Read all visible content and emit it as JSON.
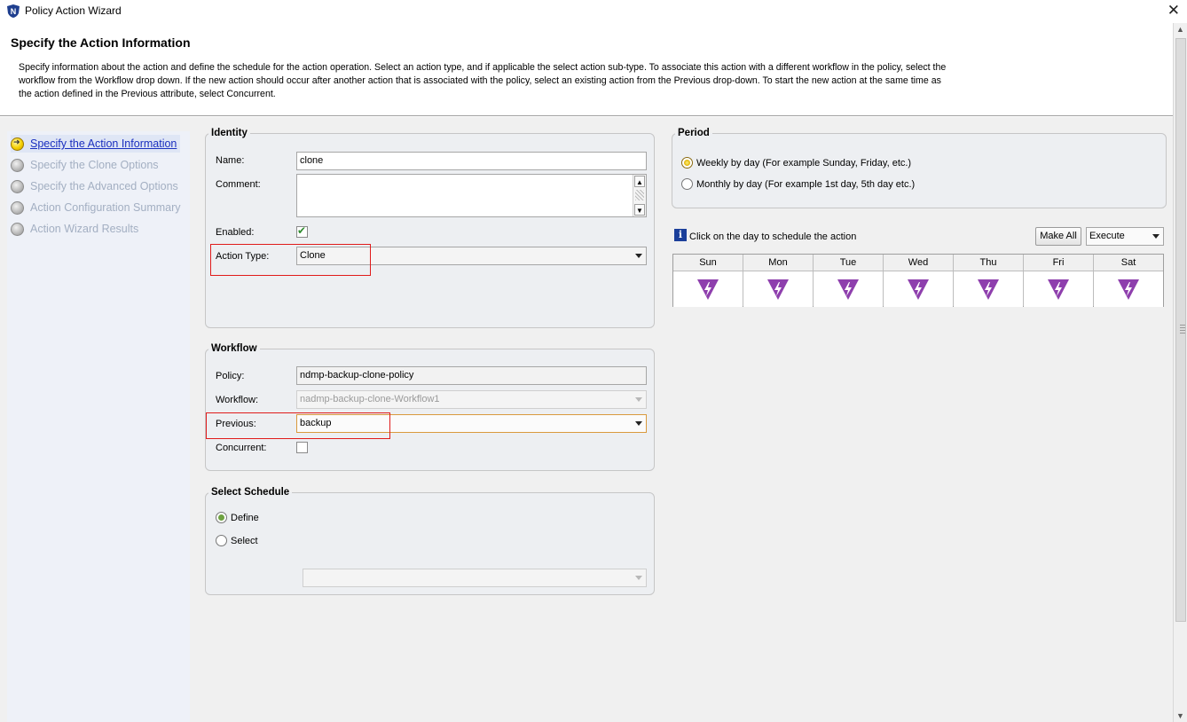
{
  "window": {
    "title": "Policy Action Wizard"
  },
  "header": {
    "title": "Specify the Action Information",
    "description": "Specify information about the action and define the schedule for the action operation. Select an action type, and if applicable the select action sub-type. To associate this action with a different workflow in the policy, select the workflow  from the Workflow drop down. If the new action should occur after another action that is associated with the policy, select an existing action from the Previous drop-down. To start the new action at the same time as the action defined in the Previous attribute, select Concurrent."
  },
  "nav": {
    "items": [
      {
        "label": "Specify the Action Information",
        "active": true
      },
      {
        "label": "Specify the Clone Options",
        "active": false
      },
      {
        "label": "Specify the Advanced Options",
        "active": false
      },
      {
        "label": "Action Configuration Summary",
        "active": false
      },
      {
        "label": "Action Wizard Results",
        "active": false
      }
    ]
  },
  "identity": {
    "legend": "Identity",
    "name_label": "Name:",
    "name_value": "clone",
    "comment_label": "Comment:",
    "comment_value": "",
    "enabled_label": "Enabled:",
    "enabled_checked": true,
    "action_type_label": "Action Type:",
    "action_type_value": "Clone"
  },
  "workflow": {
    "legend": "Workflow",
    "policy_label": "Policy:",
    "policy_value": "ndmp-backup-clone-policy",
    "workflow_label": "Workflow:",
    "workflow_value": "nadmp-backup-clone-Workflow1",
    "previous_label": "Previous:",
    "previous_value": "backup",
    "concurrent_label": "Concurrent:",
    "concurrent_checked": false
  },
  "schedule": {
    "legend": "Select Schedule",
    "define_label": "Define",
    "select_label": "Select",
    "selected": "define",
    "schedule_value": ""
  },
  "period": {
    "legend": "Period",
    "weekly_label": "Weekly by day  (For example Sunday, Friday, etc.)",
    "monthly_label": "Monthly by day (For example 1st day, 5th day etc.)",
    "selected": "weekly"
  },
  "calendar": {
    "hint": "Click on the day to schedule the action",
    "make_all_label": "Make All",
    "action_select_value": "Execute",
    "days": [
      "Sun",
      "Mon",
      "Tue",
      "Wed",
      "Thu",
      "Fri",
      "Sat"
    ],
    "day_action_icon": "execute-lightning-icon"
  },
  "colors": {
    "execute_icon": "#8e3fad",
    "highlight_box": "#e01b1b",
    "active_nav": "#1a2fbf"
  }
}
